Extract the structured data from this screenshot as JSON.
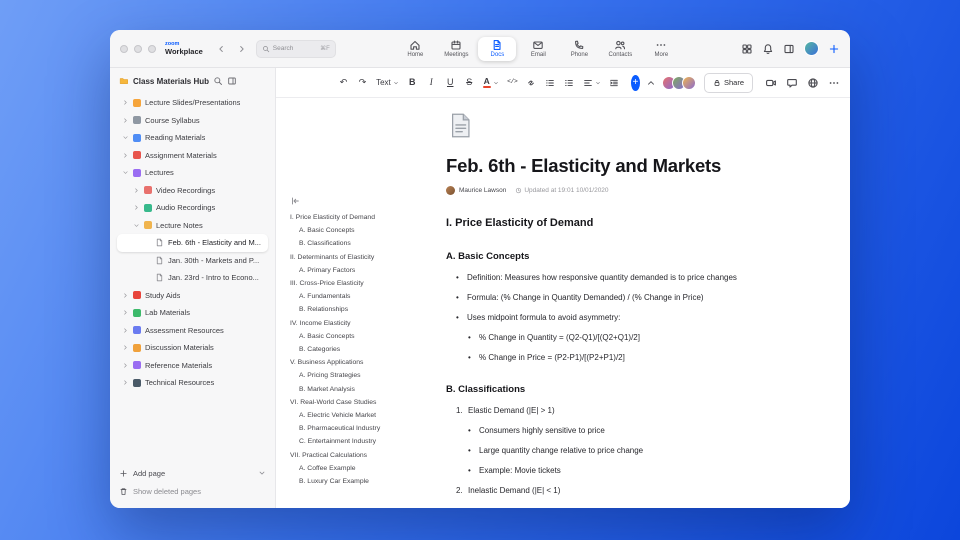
{
  "titlebar": {
    "brand_top": "zoom",
    "brand_bottom": "Workplace",
    "search": {
      "placeholder": "Search",
      "shortcut": "⌘F"
    },
    "tabs": [
      {
        "label": "Home",
        "icon": "home",
        "active": false
      },
      {
        "label": "Meetings",
        "icon": "calendar",
        "active": false
      },
      {
        "label": "Docs",
        "icon": "doc",
        "active": true
      },
      {
        "label": "Email",
        "icon": "mail",
        "active": false
      },
      {
        "label": "Phone",
        "icon": "phone",
        "active": false
      },
      {
        "label": "Contacts",
        "icon": "people",
        "active": false
      },
      {
        "label": "More",
        "icon": "more-dots",
        "active": false
      }
    ]
  },
  "sidebar": {
    "title": "Class Materials Hub",
    "items": [
      {
        "label": "Lecture Slides/Presentations",
        "level": 0,
        "chevron": "right",
        "kind": "folder",
        "color": "#f6a53c"
      },
      {
        "label": "Course Syllabus",
        "level": 0,
        "chevron": "right",
        "kind": "folder",
        "color": "#8f98a3"
      },
      {
        "label": "Reading Materials",
        "level": 0,
        "chevron": "down",
        "kind": "folder",
        "color": "#4f8df5"
      },
      {
        "label": "Assignment Materials",
        "level": 0,
        "chevron": "right",
        "kind": "folder",
        "color": "#e8554d"
      },
      {
        "label": "Lectures",
        "level": 0,
        "chevron": "down",
        "kind": "folder",
        "color": "#9a6df2"
      },
      {
        "label": "Video Recordings",
        "level": 1,
        "chevron": "right",
        "kind": "folder",
        "color": "#e8716d"
      },
      {
        "label": "Audio Recordings",
        "level": 1,
        "chevron": "right",
        "kind": "folder",
        "color": "#38b98c"
      },
      {
        "label": "Lecture Notes",
        "level": 1,
        "chevron": "down",
        "kind": "folder",
        "color": "#f0b44e"
      },
      {
        "label": "Feb. 6th - Elasticity and M...",
        "level": 2,
        "chevron": "none",
        "kind": "page",
        "selected": true
      },
      {
        "label": "Jan. 30th - Markets and P...",
        "level": 2,
        "chevron": "none",
        "kind": "page",
        "selected": false
      },
      {
        "label": "Jan. 23rd - Intro to Econo...",
        "level": 2,
        "chevron": "none",
        "kind": "page",
        "selected": false
      },
      {
        "label": "Study Aids",
        "level": 0,
        "chevron": "right",
        "kind": "folder",
        "color": "#e8453c"
      },
      {
        "label": "Lab Materials",
        "level": 0,
        "chevron": "right",
        "kind": "folder",
        "color": "#3cb96a"
      },
      {
        "label": "Assessment Resources",
        "level": 0,
        "chevron": "right",
        "kind": "folder",
        "color": "#6a7bf0"
      },
      {
        "label": "Discussion Materials",
        "level": 0,
        "chevron": "right",
        "kind": "folder",
        "color": "#f0a13c"
      },
      {
        "label": "Reference Materials",
        "level": 0,
        "chevron": "right",
        "kind": "folder",
        "color": "#9a6df2"
      },
      {
        "label": "Technical Resources",
        "level": 0,
        "chevron": "right",
        "kind": "folder",
        "color": "#4a5a68"
      }
    ],
    "footer": {
      "add_page": "Add page",
      "show_deleted": "Show deleted pages"
    }
  },
  "toolbar": {
    "buttons": [
      {
        "name": "undo",
        "glyph": "↶"
      },
      {
        "name": "redo",
        "glyph": "↷"
      },
      {
        "name": "text-style",
        "label": "Text",
        "caret": true
      },
      {
        "name": "bold",
        "glyph": "B",
        "style": "bold"
      },
      {
        "name": "italic",
        "glyph": "I",
        "style": "italic"
      },
      {
        "name": "underline",
        "glyph": "U",
        "style": "underline"
      },
      {
        "name": "strikethrough",
        "glyph": "S",
        "style": "strike"
      },
      {
        "name": "text-color",
        "glyph": "A",
        "caret": true,
        "color_bar": "#e8452c"
      },
      {
        "name": "code",
        "glyph": "</>",
        "style": "code"
      },
      {
        "name": "link",
        "icon": "link"
      },
      {
        "name": "bulleted-list",
        "icon": "list"
      },
      {
        "name": "numbered-list",
        "icon": "olist"
      },
      {
        "name": "align",
        "icon": "align",
        "caret": true
      },
      {
        "name": "indent",
        "icon": "indent"
      }
    ],
    "collaborators": [
      {
        "color": "#e8716d"
      },
      {
        "color": "#7dab5c"
      },
      {
        "color": "#f0b44e"
      }
    ],
    "share_label": "Share"
  },
  "outline": {
    "items": [
      {
        "level": 0,
        "text": "I. Price Elasticity of Demand"
      },
      {
        "level": 1,
        "text": "A. Basic Concepts"
      },
      {
        "level": 1,
        "text": "B. Classifications"
      },
      {
        "level": 0,
        "text": "II. Determinants of Elasticity"
      },
      {
        "level": 1,
        "text": "A. Primary Factors"
      },
      {
        "level": 0,
        "text": "III. Cross-Price Elasticity"
      },
      {
        "level": 1,
        "text": "A. Fundamentals"
      },
      {
        "level": 1,
        "text": "B. Relationships"
      },
      {
        "level": 0,
        "text": "IV. Income Elasticity"
      },
      {
        "level": 1,
        "text": "A. Basic Concepts"
      },
      {
        "level": 1,
        "text": "B. Categories"
      },
      {
        "level": 0,
        "text": "V. Business Applications"
      },
      {
        "level": 1,
        "text": "A. Pricing Strategies"
      },
      {
        "level": 1,
        "text": "B. Market Analysis"
      },
      {
        "level": 0,
        "text": "VI. Real-World Case Studies"
      },
      {
        "level": 1,
        "text": "A. Electric Vehicle Market"
      },
      {
        "level": 1,
        "text": "B. Pharmaceutical Industry"
      },
      {
        "level": 1,
        "text": "C. Entertainment Industry"
      },
      {
        "level": 0,
        "text": "VII. Practical Calculations"
      },
      {
        "level": 1,
        "text": "A. Coffee Example"
      },
      {
        "level": 1,
        "text": "B. Luxury Car Example"
      }
    ]
  },
  "document": {
    "title": "Feb. 6th - Elasticity and Markets",
    "author": "Maurice Lawson",
    "updated": "Updated at 19:01 10/01/2020",
    "blocks": [
      {
        "type": "h2",
        "text": "I. Price Elasticity of Demand"
      },
      {
        "type": "h3",
        "text": "A. Basic Concepts"
      },
      {
        "type": "li",
        "level": 1,
        "text": "Definition: Measures how responsive quantity demanded is to price changes"
      },
      {
        "type": "li",
        "level": 1,
        "text": "Formula: (% Change in Quantity Demanded) / (% Change in Price)"
      },
      {
        "type": "li",
        "level": 1,
        "text": "Uses midpoint formula to avoid asymmetry:"
      },
      {
        "type": "li",
        "level": 2,
        "text": "% Change in Quantity = (Q2-Q1)/[(Q2+Q1)/2]"
      },
      {
        "type": "li",
        "level": 2,
        "text": "% Change in Price = (P2-P1)/[(P2+P1)/2]"
      },
      {
        "type": "h3",
        "text": "B. Classifications"
      },
      {
        "type": "ol",
        "number": "1.",
        "text": "Elastic Demand (|E| > 1)"
      },
      {
        "type": "li",
        "level": 2,
        "text": "Consumers highly sensitive to price"
      },
      {
        "type": "li",
        "level": 2,
        "text": "Large quantity change relative to price change"
      },
      {
        "type": "li",
        "level": 2,
        "text": "Example: Movie tickets"
      },
      {
        "type": "ol",
        "number": "2.",
        "text": "Inelastic Demand (|E| < 1)"
      }
    ]
  }
}
